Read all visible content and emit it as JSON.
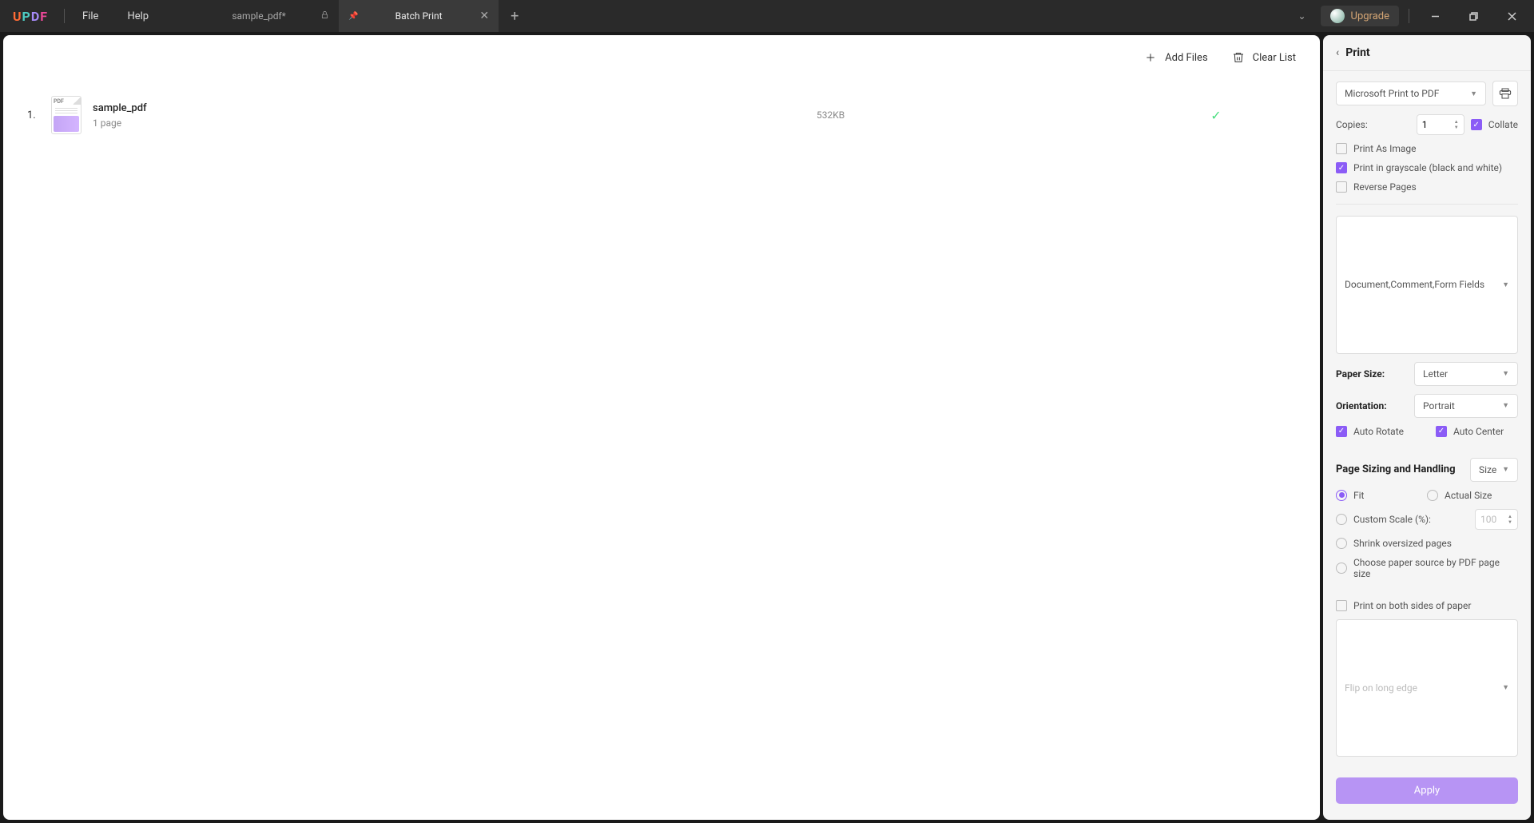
{
  "titlebar": {
    "logo": "UPDF",
    "menu": {
      "file": "File",
      "help": "Help"
    },
    "tabs": [
      {
        "label": "sample_pdf*",
        "active": false,
        "locked": true
      },
      {
        "label": "Batch Print",
        "active": true,
        "closable": true
      }
    ],
    "upgrade": "Upgrade"
  },
  "toolbar": {
    "add_files": "Add Files",
    "clear_list": "Clear List"
  },
  "files": [
    {
      "index": "1.",
      "name": "sample_pdf",
      "pages": "1 page",
      "size": "532KB",
      "status": "ok"
    }
  ],
  "panel": {
    "title": "Print",
    "printer": "Microsoft Print to PDF",
    "copies_label": "Copies:",
    "copies_value": "1",
    "collate": "Collate",
    "print_as_image": "Print As Image",
    "grayscale": "Print in grayscale (black and white)",
    "reverse_pages": "Reverse Pages",
    "content_select": "Document,Comment,Form Fields",
    "paper_size_label": "Paper Size:",
    "paper_size_value": "Letter",
    "orientation_label": "Orientation:",
    "orientation_value": "Portrait",
    "auto_rotate": "Auto Rotate",
    "auto_center": "Auto Center",
    "sizing_title": "Page Sizing and Handling",
    "sizing_select": "Size",
    "fit": "Fit",
    "actual_size": "Actual Size",
    "custom_scale": "Custom Scale (%):",
    "custom_scale_value": "100",
    "shrink": "Shrink oversized pages",
    "paper_source": "Choose paper source by PDF page size",
    "both_sides": "Print on both sides of paper",
    "flip": "Flip on long edge",
    "apply": "Apply"
  }
}
